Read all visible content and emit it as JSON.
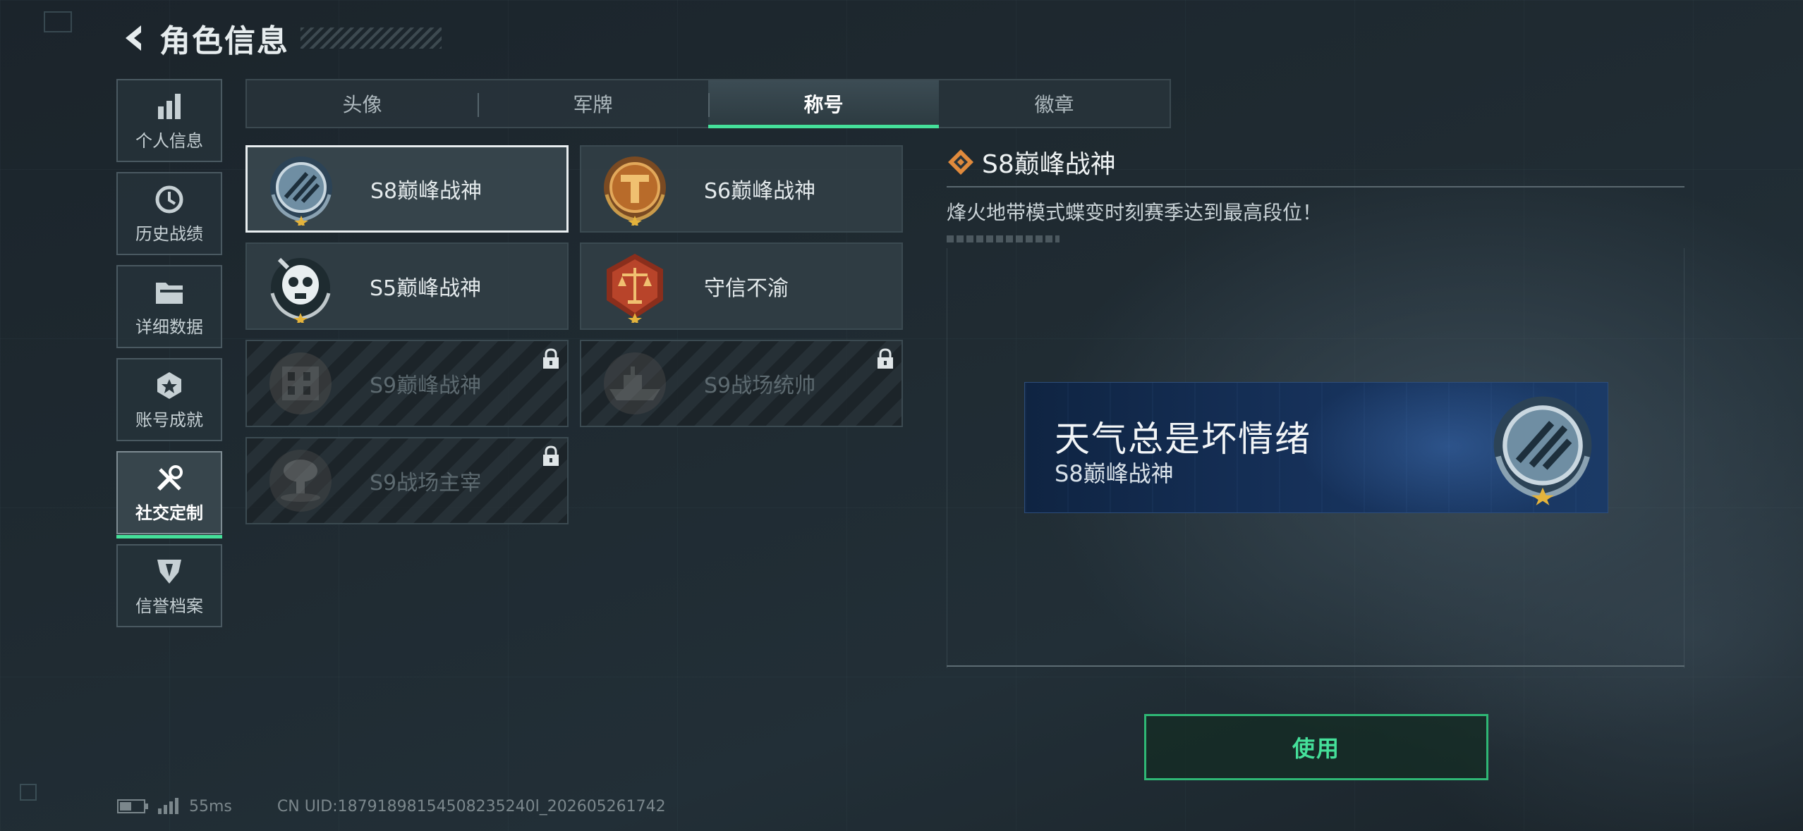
{
  "header": {
    "title": "角色信息",
    "back_icon": "back-arrow-icon"
  },
  "nav": {
    "items": [
      {
        "label": "个人信息",
        "icon": "bar-chart-icon",
        "active": false
      },
      {
        "label": "历史战绩",
        "icon": "history-clock-icon",
        "active": false
      },
      {
        "label": "详细数据",
        "icon": "folder-icon",
        "active": false
      },
      {
        "label": "账号成就",
        "icon": "achievement-icon",
        "active": false
      },
      {
        "label": "社交定制",
        "icon": "tools-icon",
        "active": true
      },
      {
        "label": "信誉档案",
        "icon": "shield-emblem-icon",
        "active": false
      }
    ]
  },
  "tabs": [
    {
      "label": "头像",
      "active": false
    },
    {
      "label": "军牌",
      "active": false
    },
    {
      "label": "称号",
      "active": true
    },
    {
      "label": "徽章",
      "active": false
    }
  ],
  "titles": [
    {
      "name": "S8巅峰战神",
      "emblem": "s8-laurel-emblem-icon",
      "selected": true,
      "locked": false
    },
    {
      "name": "S6巅峰战神",
      "emblem": "s6-gold-emblem-icon",
      "selected": false,
      "locked": false
    },
    {
      "name": "S5巅峰战神",
      "emblem": "s5-skull-emblem-icon",
      "selected": false,
      "locked": false
    },
    {
      "name": "守信不渝",
      "emblem": "scales-emblem-icon",
      "selected": false,
      "locked": false
    },
    {
      "name": "S9巅峰战神",
      "emblem": "s9-building-emblem-icon",
      "selected": false,
      "locked": true
    },
    {
      "name": "S9战场统帅",
      "emblem": "s9-ship-emblem-icon",
      "selected": false,
      "locked": true
    },
    {
      "name": "S9战场主宰",
      "emblem": "s9-explosion-emblem-icon",
      "selected": false,
      "locked": true
    }
  ],
  "detail": {
    "title": "S8巅峰战神",
    "description": "烽火地带模式蝶变时刻赛季达到最高段位！",
    "title_icon": "diamond-marker-icon"
  },
  "banner": {
    "player_name": "天气总是坏情绪",
    "player_title": "S8巅峰战神",
    "emblem": "s8-laurel-emblem-icon"
  },
  "use_button": {
    "label": "使用"
  },
  "status": {
    "battery_icon": "battery-icon",
    "signal_icon": "signal-icon",
    "ping": "55ms",
    "uid": "CN UID:18791898154508235240l_202605261742"
  },
  "colors": {
    "accent_green": "#45e09a",
    "banner_blue": "#16315a"
  }
}
